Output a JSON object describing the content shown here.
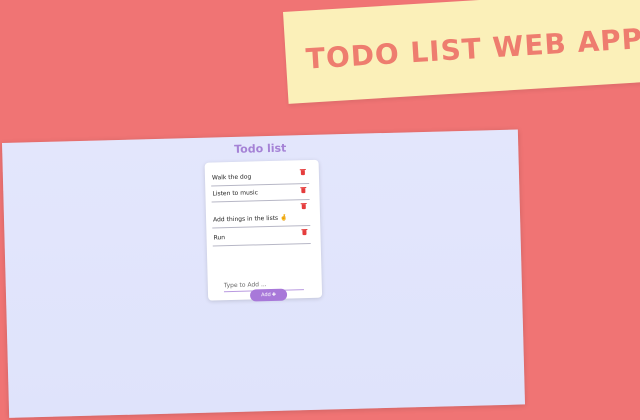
{
  "banner": {
    "title": "TODO LIST WEB APP"
  },
  "app": {
    "title": "Todo list",
    "items": [
      {
        "label": "Walk the dog"
      },
      {
        "label": "Listen to music"
      },
      {
        "label": "Add things in the lists 🤞"
      },
      {
        "label": "Run"
      }
    ],
    "input": {
      "placeholder": "Type to Add ...",
      "value": ""
    },
    "add_button": {
      "label": "Add",
      "icon": "plus-icon"
    }
  },
  "colors": {
    "background": "#f07474",
    "banner": "#fbf0b9",
    "banner_text": "#ee7d6f",
    "screen": "#e1e4fb",
    "accent": "#a878d9",
    "delete": "#e53c3c"
  }
}
